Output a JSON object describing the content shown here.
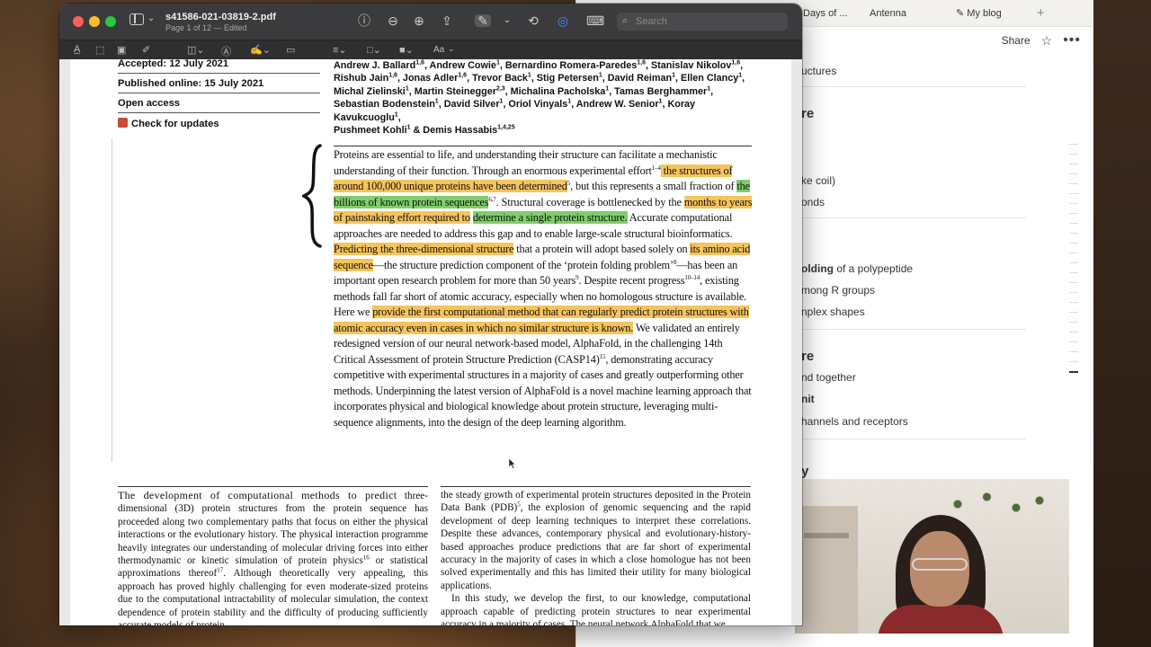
{
  "browser": {
    "tabs": [
      {
        "label": "Days of ..."
      },
      {
        "label": "Antenna"
      },
      {
        "label": "My blog",
        "icon": "pencil-emoji-icon"
      }
    ],
    "share_label": "Share",
    "notion_lines": [
      "uctures",
      "re",
      "ke coil)",
      "onds",
      "olding",
      " of a polypeptide",
      "mong R groups",
      "nplex shapes",
      "re",
      "nd together",
      "nit",
      "hannels and receptors",
      "y"
    ]
  },
  "pdf": {
    "title": "s41586-021-03819-2.pdf",
    "subtitle": "Page 1 of 12 — Edited",
    "search_placeholder": "Search",
    "markup_font_label": "Aa",
    "meta": {
      "accepted": "Accepted: 12 July 2021",
      "published": "Published online: 15 July 2021",
      "open_access": "Open access",
      "check_updates": "Check for updates"
    },
    "authors": {
      "line1": "Andrew J. Ballard",
      "line1b": ", Andrew Cowie",
      "line1c": ", Bernardino Romera-Paredes",
      "line1d": ", Stanislav Nikolov",
      "line2": "Rishub Jain",
      "line2b": ", Jonas Adler",
      "line2c": ", Trevor Back",
      "line2d": ", Stig Petersen",
      "line2e": ", David Reiman",
      "line2f": ", Ellen Clancy",
      "line3": "Michal Zielinski",
      "line3b": ", Martin Steinegger",
      "line3c": ", Michalina Pacholska",
      "line3d": ", Tamas Berghammer",
      "line4": "Sebastian Bodenstein",
      "line4b": ", David Silver",
      "line4c": ", Oriol Vinyals",
      "line4d": ", Andrew W. Senior",
      "line4e": ", Koray Kavukcuoglu",
      "line5": "Pushmeet Kohli",
      "line5b": " & Demis Hassabis"
    },
    "abstract": {
      "p1": "Proteins are essential to life, and understanding their structure can facilitate a mechanistic understanding of their function. Through an enormous experimental effort",
      "hl1": " the structures of around 100,000 unique proteins have been determined",
      "p2": ", but this represents a small fraction of ",
      "hl2": "the billions of known protein sequences",
      "p3": ". Structural coverage is bottlenecked by the ",
      "hl3": "months to years of painstaking effort required to",
      "hl4": "determine a single protein structure.",
      "p4": " Accurate computational approaches are needed to address this gap and to enable large-scale structural bioinformatics. ",
      "hl5": "Predicting the three-dimensional structure",
      "p5": " that a protein will adopt based solely on ",
      "hl6": "its amino acid sequence",
      "p6": "—the structure prediction component of the ‘protein folding problem’",
      "p7": "—has been an important open research problem for more than 50 years",
      "p8": ". Despite recent progress",
      "p9": ", existing methods fall far short of atomic accuracy, especially when no homologous structure is available. Here we ",
      "hl7": "provide the first computational method that can regularly predict protein structures with atomic accuracy even in cases in which no similar structure is known.",
      "p10": " We validated an entirely redesigned version of our neural network-based model, AlphaFold, in the challenging 14th Critical Assessment of protein Structure Prediction (CASP14)",
      "p11": ", demonstrating accuracy competitive with experimental structures in a majority of cases and greatly outperforming other methods. Underpinning the latest version of AlphaFold is a novel machine learning approach that incorporates physical and biological knowledge about protein structure, leveraging multi-sequence alignments, into the design of the deep learning algorithm."
    },
    "sup": {
      "s1": "1–4",
      "s2": "5",
      "s3": "6,7",
      "s4": "8",
      "s5": "9",
      "s6": "10–14",
      "s7": "15",
      "a1": "1,6",
      "a2": "1",
      "a3": "1,6",
      "a4": "1,6",
      "a5": "1,6",
      "a6": "1,6",
      "a7": "1",
      "a8": "1",
      "a9": "1",
      "a10": "1",
      "a11": "1",
      "a12": "2,3",
      "a13": "1",
      "a14": "1",
      "a15": "1",
      "a16": "1",
      "a17": "1",
      "a18": "1",
      "a19": "1",
      "a20": "1",
      "a21": "1,4,25"
    },
    "body_left": {
      "lead": "The development of computational methods to predict",
      "text": "three-dimensional (3D) protein structures from the protein sequence has proceeded along two complementary paths that focus on either the physical interactions or the evolutionary history. The physical interaction programme heavily integrates our understanding of molecular driving forces into either thermodynamic or kinetic simulation of protein physics",
      "sup1": "16",
      "text2": " or statistical approximations thereof",
      "sup2": "17",
      "text3": ". Although theoretically very appealing, this approach has proved highly challenging for even moderate-sized proteins due to the computational intractability of molecular simulation, the context dependence of protein stability and the difficulty of producing sufficiently accurate models of protein"
    },
    "body_right": {
      "text": "the steady growth of experimental protein structures deposited in the Protein Data Bank (PDB)",
      "sup1": "5",
      "text2": ", the explosion of genomic sequencing and the rapid development of deep learning techniques to interpret these correlations. Despite these advances, contemporary physical and evolutionary-history-based approaches produce predictions that are far short of experimental accuracy in the majority of cases in which a close homologue has not been solved experimentally and this has limited their utility for many biological applications.",
      "para2": "In this study, we develop the first, to our knowledge, computational approach capable of predicting protein structures to near experimental accuracy in a majority of cases. The neural network AlphaFold that we"
    },
    "colors": {
      "highlight_orange": "#f6c45c",
      "highlight_green": "#7fce6a",
      "titlebar": "#3b3b3d"
    }
  }
}
